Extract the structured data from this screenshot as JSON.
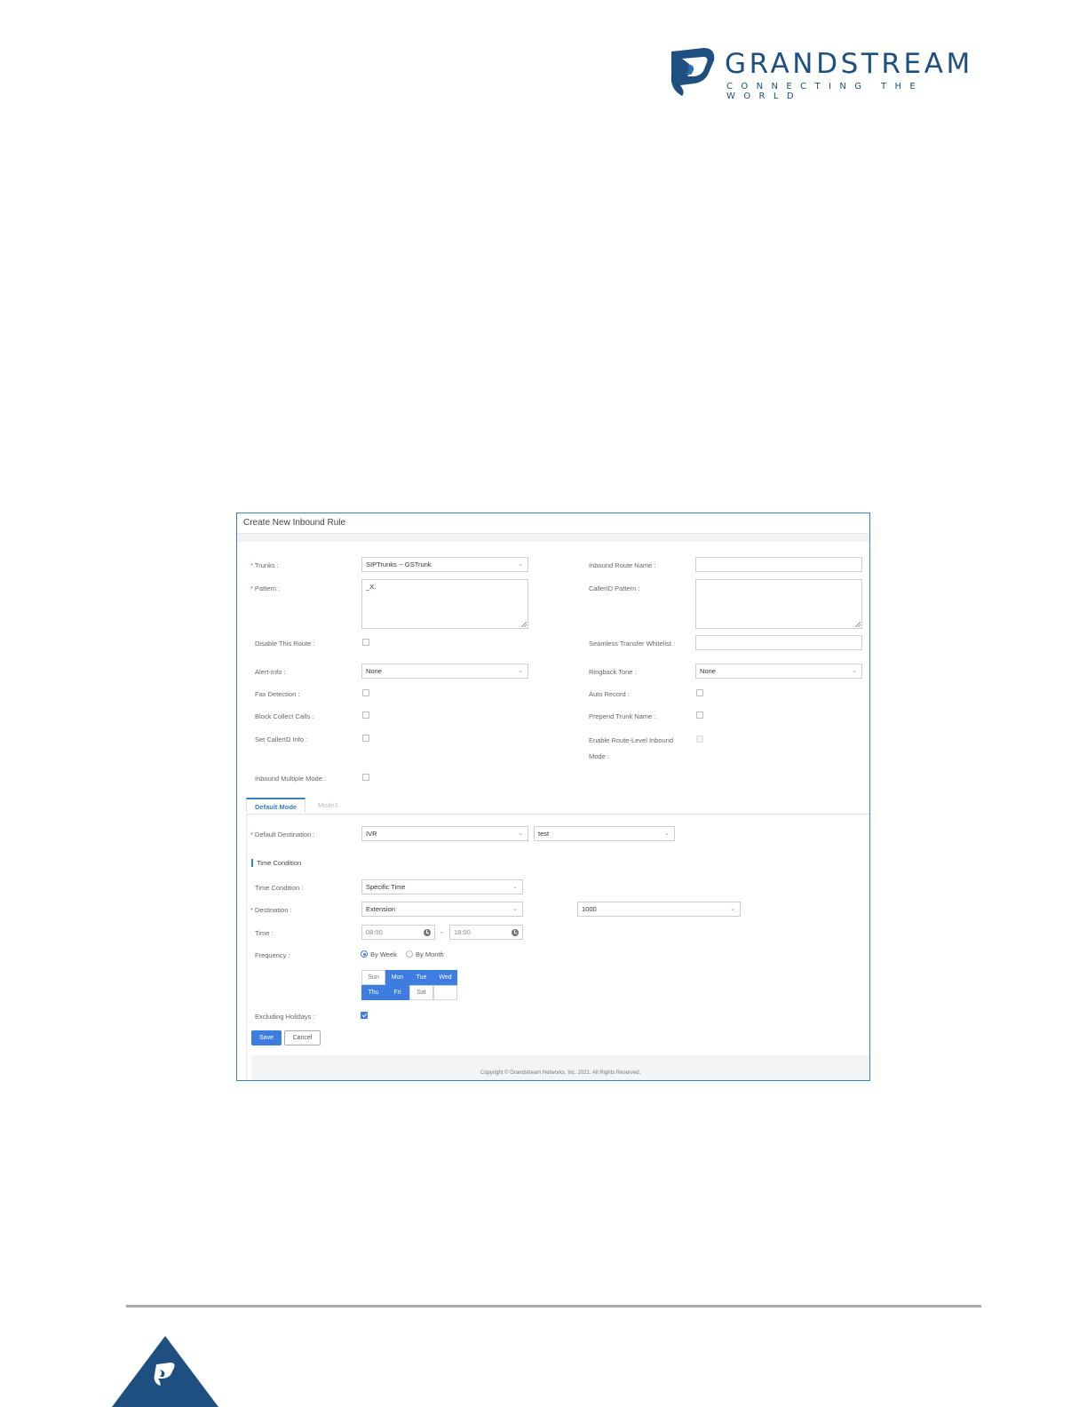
{
  "brand": {
    "name": "GRANDSTREAM",
    "tagline": "CONNECTING THE WORLD",
    "primary_color": "#1f4f80",
    "accent_color": "#2a6fb0"
  },
  "panel": {
    "title": "Create New Inbound Rule",
    "left": {
      "trunks_label": "Trunks :",
      "trunks_value": "SIPTrunks -- GSTrunk",
      "pattern_label": "Pattern :",
      "pattern_value": "_X.",
      "disable_route_label": "Disable This Route :",
      "alert_info_label": "Alert-Info :",
      "alert_info_value": "None",
      "fax_detection_label": "Fax Detection :",
      "block_collect_label": "Block Collect Calls :",
      "set_callerid_label": "Set CallerID Info :",
      "inbound_multiple_label": "Inbound Multiple Mode :"
    },
    "right": {
      "route_name_label": "Inbound Route Name :",
      "route_name_value": "",
      "callerid_pattern_label": "CallerID Pattern :",
      "callerid_pattern_value": "",
      "seamless_label": "Seamless Transfer Whitelist :",
      "seamless_value": "",
      "ringback_label": "Ringback Tone :",
      "ringback_value": "None",
      "auto_record_label": "Auto Record :",
      "prepend_label": "Prepend Trunk Name :",
      "enable_route_level_label_1": "Enable Route-Level Inbound",
      "enable_route_level_label_2": "Mode :"
    },
    "tabs": [
      "Default Mode",
      "Mode1"
    ],
    "default_destination": {
      "label": "Default Destination :",
      "type_value": "IVR",
      "target_value": "test"
    },
    "time_condition_section": "Time Condition",
    "time_condition": {
      "label": "Time Condition :",
      "value": "Specific Time",
      "destination_label": "Destination :",
      "destination_type": "Extension",
      "destination_target": "1000",
      "time_label": "Time :",
      "time_start": "08:00",
      "time_sep": "-",
      "time_end": "18:00",
      "frequency_label": "Frequency :",
      "frequency_by_week": "By Week",
      "frequency_by_month": "By Month",
      "frequency_selected": "By Week",
      "days": [
        {
          "label": "Sun",
          "selected": false
        },
        {
          "label": "Mon",
          "selected": true
        },
        {
          "label": "Tue",
          "selected": true
        },
        {
          "label": "Wed",
          "selected": true
        },
        {
          "label": "Thu",
          "selected": true
        },
        {
          "label": "Fri",
          "selected": true
        },
        {
          "label": "Sat",
          "selected": false
        }
      ],
      "excluding_holidays_label": "Excluding Holidays :",
      "excluding_holidays_checked": true
    },
    "buttons": {
      "save": "Save",
      "cancel": "Cancel"
    },
    "copyright": "Copyright © Grandstream Networks, Inc. 2021. All Rights Reserved."
  }
}
